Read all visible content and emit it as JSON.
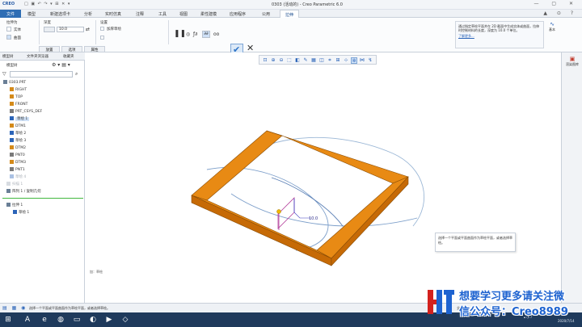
{
  "titlebar": {
    "app": "CREO",
    "title": "0303 (活动的) - Creo Parametric 6.0"
  },
  "menu": {
    "file": "文件",
    "tabs": [
      "模型",
      "新建选项卡",
      "分析",
      "实时仿真",
      "注释",
      "工具",
      "视图",
      "柔性建模",
      "应用程序",
      "公用",
      "拉伸"
    ]
  },
  "ribbon": {
    "type_label": "拉伸为",
    "solid_label": "实体",
    "surface_label": "曲面",
    "depth_label": "深度",
    "depth_value": "10.0",
    "settings_label": "设置",
    "thicken_label": "加厚草绘",
    "confirm_label": "确定",
    "cancel_label": "取消",
    "sub_tabs": [
      "放置",
      "选项",
      "属性"
    ],
    "help_text": "通过指定草绘平面并在 2D 截面中生成实体或曲面，拉伸时控制材料的长度，深度为 10.0 个单位。",
    "help_link": "了解更多...",
    "right_icon_label": "基本"
  },
  "left_panel": {
    "tabs": [
      "模型树",
      "文件夹浏览器",
      "收藏夹"
    ],
    "tree_label": "模型树",
    "tree": [
      {
        "label": "0303.PRT",
        "icon": "part-icon",
        "state": "normal"
      },
      {
        "label": "RIGHT",
        "icon": "datum-plane-icon",
        "state": "normal"
      },
      {
        "label": "TOP",
        "icon": "datum-plane-icon",
        "state": "normal"
      },
      {
        "label": "FRONT",
        "icon": "datum-plane-icon",
        "state": "normal"
      },
      {
        "label": "PRT_CSYS_DEF",
        "icon": "csys-icon",
        "state": "normal"
      },
      {
        "label": "草绘 1",
        "icon": "sketch-icon",
        "state": "selected"
      },
      {
        "label": "DTM1",
        "icon": "datum-plane-icon",
        "state": "normal"
      },
      {
        "label": "草绘 2",
        "icon": "sketch-icon",
        "state": "normal"
      },
      {
        "label": "草绘 3",
        "icon": "sketch-icon",
        "state": "normal"
      },
      {
        "label": "DTM2",
        "icon": "datum-plane-icon",
        "state": "normal"
      },
      {
        "label": "PNT0",
        "icon": "datum-point-icon",
        "state": "normal"
      },
      {
        "label": "DTM3",
        "icon": "datum-plane-icon",
        "state": "normal"
      },
      {
        "label": "PNT1",
        "icon": "datum-point-icon",
        "state": "normal"
      },
      {
        "label": "草绘 4",
        "icon": "sketch-icon",
        "state": "dim"
      },
      {
        "label": "扫描 1",
        "icon": "sweep-icon",
        "state": "dim"
      },
      {
        "label": "阵列 1 / 复制几何",
        "icon": "pattern-icon",
        "state": "normal"
      },
      {
        "label": "拉伸 1",
        "icon": "extrude-icon",
        "state": "normal"
      },
      {
        "label": "草绘 1",
        "icon": "sketch-icon",
        "state": "normal"
      }
    ]
  },
  "graphics": {
    "dimension": "10.0",
    "sketch_label": "加：草绘",
    "tip_text": "选择一个平面或平面曲面作为草绘平面，或者选择草绘。"
  },
  "right_dock": {
    "label": "渲染图库"
  },
  "statusbar": {
    "message": "选择一个平面或平面曲面作为草绘平面，或者选择草绘。",
    "right": "全部"
  },
  "taskbar": {
    "clock": "2020/7/14"
  },
  "watermark": {
    "line1": "想要学习更多请关注微",
    "line2": "信公众号：Creo8989"
  },
  "colors": {
    "frame_top": "#e88a14",
    "frame_side": "#c66a06",
    "accent": "#2e6db4"
  }
}
